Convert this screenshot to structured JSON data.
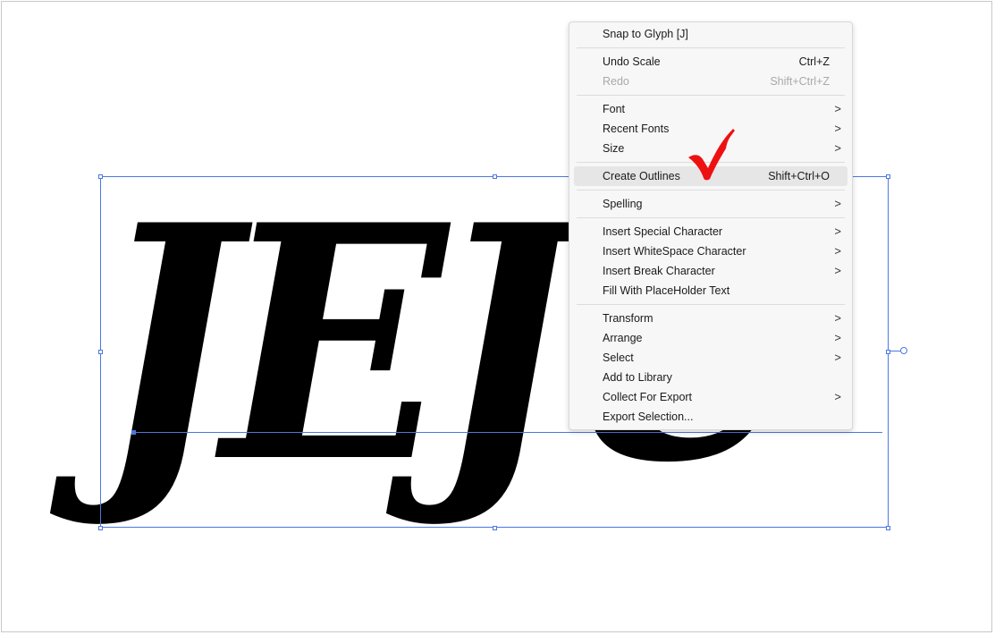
{
  "artwork": {
    "text": "JEJU"
  },
  "context_menu": {
    "groups": [
      [
        {
          "label": "Snap to Glyph [J]",
          "shortcut": "",
          "submenu": false,
          "disabled": false
        }
      ],
      [
        {
          "label": "Undo Scale",
          "shortcut": "Ctrl+Z",
          "submenu": false,
          "disabled": false
        },
        {
          "label": "Redo",
          "shortcut": "Shift+Ctrl+Z",
          "submenu": false,
          "disabled": true
        }
      ],
      [
        {
          "label": "Font",
          "shortcut": "",
          "submenu": true,
          "disabled": false
        },
        {
          "label": "Recent Fonts",
          "shortcut": "",
          "submenu": true,
          "disabled": false
        },
        {
          "label": "Size",
          "shortcut": "",
          "submenu": true,
          "disabled": false
        }
      ],
      [
        {
          "label": "Create Outlines",
          "shortcut": "Shift+Ctrl+O",
          "submenu": false,
          "disabled": false,
          "highlighted": true
        }
      ],
      [
        {
          "label": "Spelling",
          "shortcut": "",
          "submenu": true,
          "disabled": false
        }
      ],
      [
        {
          "label": "Insert Special Character",
          "shortcut": "",
          "submenu": true,
          "disabled": false
        },
        {
          "label": "Insert WhiteSpace Character",
          "shortcut": "",
          "submenu": true,
          "disabled": false
        },
        {
          "label": "Insert Break Character",
          "shortcut": "",
          "submenu": true,
          "disabled": false
        },
        {
          "label": "Fill With PlaceHolder Text",
          "shortcut": "",
          "submenu": false,
          "disabled": false
        }
      ],
      [
        {
          "label": "Transform",
          "shortcut": "",
          "submenu": true,
          "disabled": false
        },
        {
          "label": "Arrange",
          "shortcut": "",
          "submenu": true,
          "disabled": false
        },
        {
          "label": "Select",
          "shortcut": "",
          "submenu": true,
          "disabled": false
        },
        {
          "label": "Add to Library",
          "shortcut": "",
          "submenu": false,
          "disabled": false
        },
        {
          "label": "Collect For Export",
          "shortcut": "",
          "submenu": true,
          "disabled": false
        },
        {
          "label": "Export Selection...",
          "shortcut": "",
          "submenu": false,
          "disabled": false
        }
      ]
    ],
    "submenu_arrow": ">"
  },
  "annotation": {
    "icon": "red-check-icon",
    "color": "#ee1111"
  },
  "colors": {
    "selection": "#4b78e0",
    "menu_bg": "#f7f7f7",
    "menu_highlight": "#e6e6e6"
  }
}
